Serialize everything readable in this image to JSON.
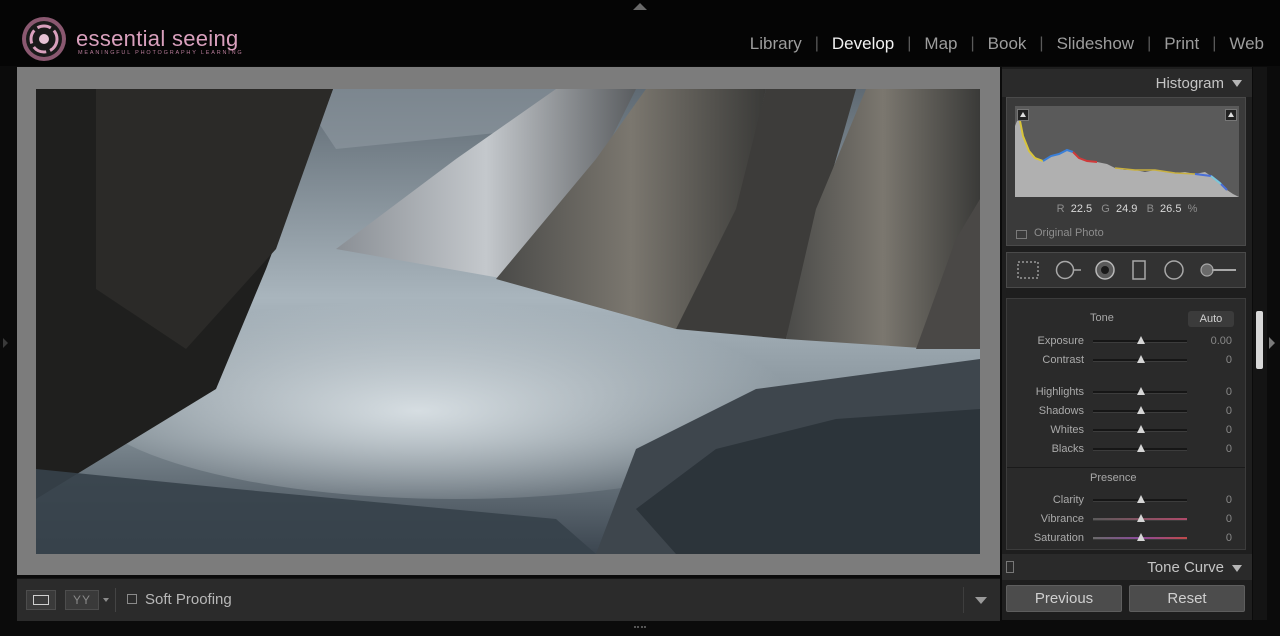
{
  "brand": {
    "name": "essential seeing",
    "tagline": "MEANINGFUL PHOTOGRAPHY LEARNING",
    "color": "#d9a0bd"
  },
  "modules": [
    {
      "label": "Library",
      "active": false
    },
    {
      "label": "Develop",
      "active": true
    },
    {
      "label": "Map",
      "active": false
    },
    {
      "label": "Book",
      "active": false
    },
    {
      "label": "Slideshow",
      "active": false
    },
    {
      "label": "Print",
      "active": false
    },
    {
      "label": "Web",
      "active": false
    }
  ],
  "toolbar": {
    "loupe_icon": "loupe-view-icon",
    "compare_label": "YY",
    "soft_proofing_label": "Soft Proofing",
    "soft_proofing_checked": false
  },
  "right_panel": {
    "histogram": {
      "title": "Histogram",
      "r_label": "R",
      "r_value": "22.5",
      "g_label": "G",
      "g_value": "24.9",
      "b_label": "B",
      "b_value": "26.5",
      "unit": "%",
      "original_photo_label": "Original Photo"
    },
    "tools": [
      "crop-overlay-icon",
      "spot-removal-icon",
      "red-eye-icon",
      "graduated-filter-icon",
      "radial-filter-icon",
      "adjustment-brush-icon"
    ],
    "basic": {
      "tone_title": "Tone",
      "auto_label": "Auto",
      "presence_title": "Presence",
      "tone_sliders": [
        {
          "label": "Exposure",
          "value": "0.00"
        },
        {
          "label": "Contrast",
          "value": "0"
        },
        {
          "label": "Highlights",
          "value": "0"
        },
        {
          "label": "Shadows",
          "value": "0"
        },
        {
          "label": "Whites",
          "value": "0"
        },
        {
          "label": "Blacks",
          "value": "0"
        }
      ],
      "presence_sliders": [
        {
          "label": "Clarity",
          "value": "0"
        },
        {
          "label": "Vibrance",
          "value": "0"
        },
        {
          "label": "Saturation",
          "value": "0"
        }
      ]
    },
    "tone_curve_title": "Tone Curve",
    "previous_label": "Previous",
    "reset_label": "Reset"
  }
}
